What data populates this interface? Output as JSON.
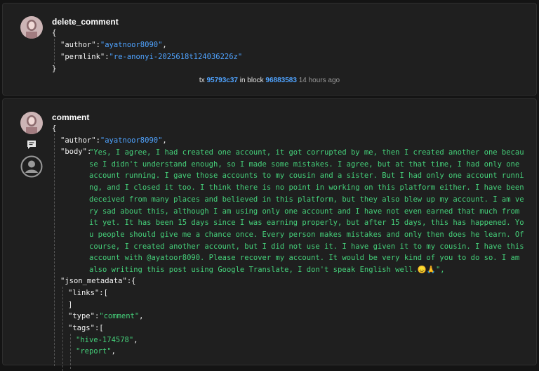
{
  "ops": [
    {
      "type": "delete_comment",
      "lines": {
        "open": "{",
        "author_key": "\"author\"",
        "author_val": "\"ayatnoor8090\"",
        "permlink_key": "\"permlink\"",
        "permlink_val": "\"re-anonyi-2025618t124036226z\"",
        "close": "}"
      },
      "tx_label": "tx",
      "tx_id": "95793c37",
      "block_label": "in block",
      "block_num": "96883583",
      "time_ago": "14 hours ago"
    },
    {
      "type": "comment",
      "open": "{",
      "author_key": "\"author\"",
      "author_val": "\"ayatnoor8090\"",
      "body_key": "\"body\"",
      "body_val": "\"Yes, I agree, I had created one account, it got corrupted by me, then I created another one because I didn't understand enough, so I made some mistakes. I agree, but at that time, I had only one account running. I gave those accounts to my cousin and a sister. But I had only one account running, and I closed it too. I think there is no point in working on this platform either. I have been deceived from many places and believed in this platform, but they also blew up my account. I am very sad about this, although I am using only one account and I have not even earned that much from it yet. It has been 15 days since I was earning properly, but after 15 days, this has happened. You people should give me a chance once. Every person makes mistakes and only then does he learn. Of course, I created another account, but I did not use it. I have given it to my cousin. I have this account with @ayatoor8090. Please recover my account. It would be very kind of you to do so. I am also writing this post using Google Translate, I don't speak English well.😞🙏\",",
      "json_metadata_key": "\"json_metadata\"",
      "links_key": "\"links\"",
      "links_close": "]",
      "type_key": "\"type\"",
      "type_val": "\"comment\"",
      "tags_key": "\"tags\"",
      "tags": [
        "\"hive-174578\"",
        "\"report\""
      ]
    }
  ],
  "icons": [
    "avatar",
    "comment-icon",
    "user-circle-icon"
  ]
}
